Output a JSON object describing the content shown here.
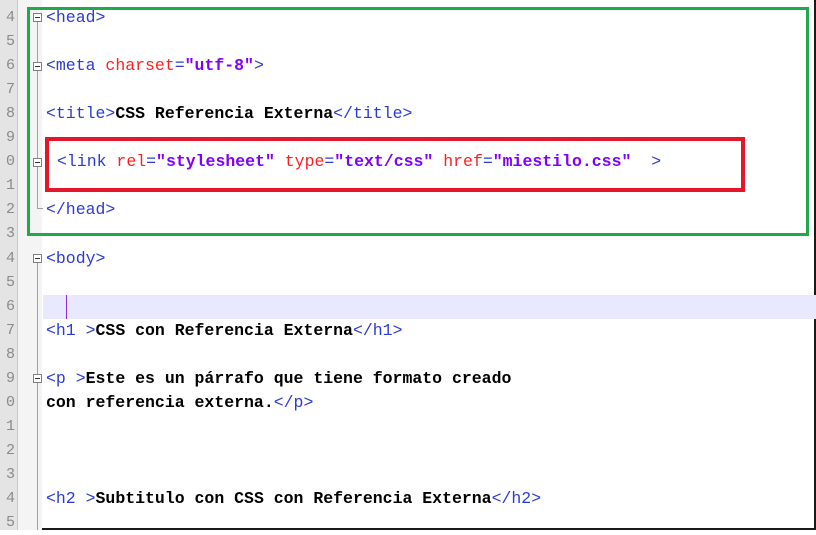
{
  "editor": {
    "line_numbers": [
      "4",
      "5",
      "6",
      "7",
      "8",
      "9",
      "0",
      "1",
      "2",
      "3",
      "4",
      "5",
      "6",
      "7",
      "8",
      "9",
      "0",
      "1",
      "2",
      "3",
      "4",
      "5"
    ],
    "lines": {
      "head_open": "<head>",
      "meta_tag_open": "<meta",
      "meta_attr": "charset",
      "meta_eq": "=",
      "meta_val": "\"utf-8\"",
      "meta_close": ">",
      "title_open": "<title>",
      "title_text": "CSS Referencia Externa",
      "title_close": "</title>",
      "link_open": "<link",
      "link_rel_attr": "rel",
      "link_rel_eq": "=",
      "link_rel_val": "\"stylesheet\"",
      "link_type_attr": "type",
      "link_type_eq": "=",
      "link_type_val": "\"text/css\"",
      "link_href_attr": "href",
      "link_href_eq": "=",
      "link_href_val": "\"miestilo.css\"",
      "link_close": ">",
      "head_close": "</head>",
      "body_open": "<body>",
      "h1_open": "<h1 >",
      "h1_text": "CSS con Referencia Externa",
      "h1_close": "</h1>",
      "p_open": "<p >",
      "p_text_1": "Este es un párrafo que tiene formato creado",
      "p_text_2": "con referencia externa.",
      "p_close": "</p>",
      "h2_open": "<h2 >",
      "h2_text": "Subtitulo con CSS con Referencia Externa",
      "h2_close": "</h2>"
    }
  },
  "highlight_colors": {
    "green": "#22a84a",
    "red": "#e4162a"
  }
}
